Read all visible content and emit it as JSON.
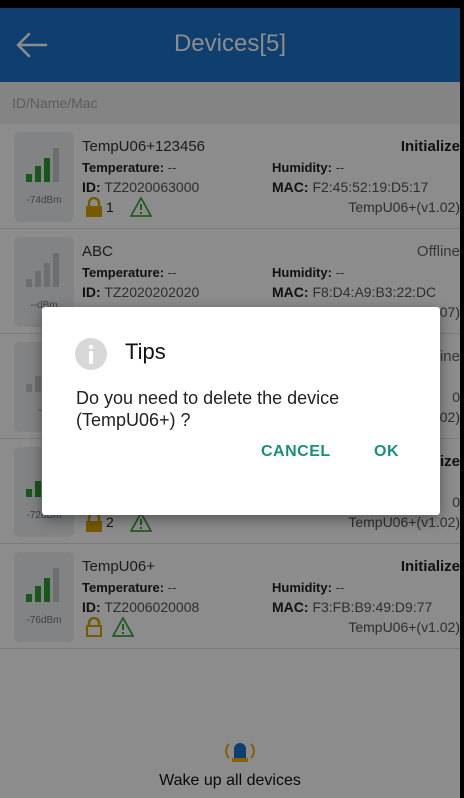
{
  "header": {
    "title": "Devices[5]"
  },
  "search": {
    "placeholder": "ID/Name/Mac"
  },
  "labels": {
    "temperature": "Temperature:",
    "humidity": "Humidity:",
    "id": "ID:",
    "mac": "MAC:"
  },
  "devices": [
    {
      "name": "TempU06+123456",
      "status": "Initialize",
      "rssi": "-74dBm",
      "temperature": "--",
      "humidity": "--",
      "id": "TZ2020063000",
      "mac": "F2:45:52:19:D5:17",
      "version": "TempU06+(v1.02)",
      "lock_count": "1"
    },
    {
      "name": "ABC",
      "status": "Offline",
      "rssi": "--dBm",
      "temperature": "--",
      "humidity": "--",
      "id": "TZ2020202020",
      "mac": "F8:D4:A9:B3:22:DC",
      "version": "TempU06+(v1.07)",
      "lock_count": ""
    },
    {
      "name": "",
      "status": "ine",
      "rssi": "--d",
      "temperature": "",
      "humidity": "",
      "id": "",
      "mac": "0",
      "version": "02)",
      "lock_count": ""
    },
    {
      "name": "",
      "status": "Initialize",
      "rssi": "-72dBm",
      "temperature": "",
      "humidity": "",
      "id": "",
      "mac": "0",
      "version": "TempU06+(v1.02)",
      "lock_count": "2"
    },
    {
      "name": "TempU06+",
      "status": "Initialize",
      "rssi": "-76dBm",
      "temperature": "--",
      "humidity": "--",
      "id": "TZ2006020008",
      "mac": "F3:FB:B9:49:D9:77",
      "version": "TempU06+(v1.02)",
      "lock_count": ""
    }
  ],
  "dialog": {
    "title": "Tips",
    "message": "Do you need to delete the device (TempU06+) ?",
    "cancel": "CANCEL",
    "ok": "OK"
  },
  "footer": {
    "wake_all": "Wake up all devices"
  },
  "colors": {
    "appbar": "#1a73c9",
    "accent": "#17907c",
    "signal_green": "#2e9d2e",
    "lock": "#d6a400",
    "warning": "#3fa53f"
  },
  "icons": {
    "back": "arrow-left-icon",
    "signal": "signal-bars-icon",
    "lock": "padlock-icon",
    "warning": "warning-triangle-icon",
    "info": "info-icon",
    "bell": "alarm-bell-icon"
  }
}
